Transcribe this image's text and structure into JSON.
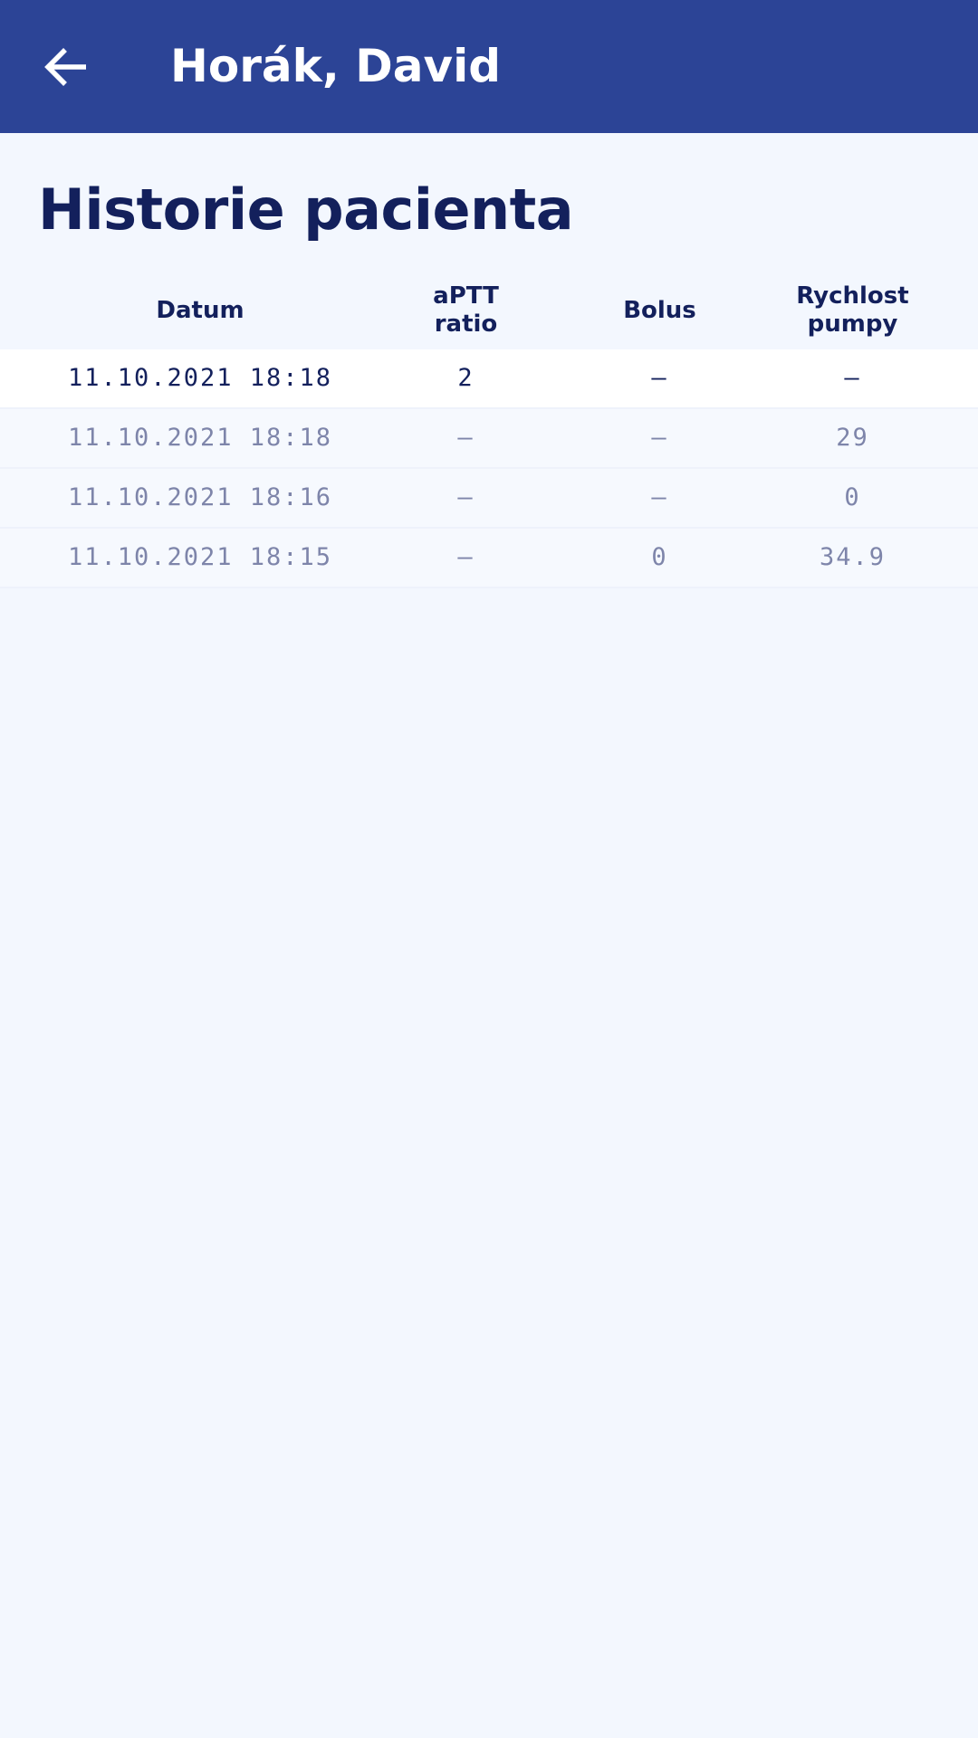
{
  "app_bar": {
    "title": "Horák, David",
    "back_icon": "arrow-left-icon",
    "background": "#2c4496"
  },
  "page": {
    "title": "Historie pacienta"
  },
  "table": {
    "headers": {
      "date": "Datum",
      "aptt": "aPTT ratio",
      "bolus": "Bolus",
      "rate_line1": "Rychlost",
      "rate_line2": "pumpy"
    },
    "rows": [
      {
        "date": "11.10.2021 18:18",
        "aptt": "2",
        "bolus": "–",
        "rate": "–",
        "active": true
      },
      {
        "date": "11.10.2021 18:18",
        "aptt": "–",
        "bolus": "–",
        "rate": "29",
        "active": false
      },
      {
        "date": "11.10.2021 18:16",
        "aptt": "–",
        "bolus": "–",
        "rate": "0",
        "active": false
      },
      {
        "date": "11.10.2021 18:15",
        "aptt": "–",
        "bolus": "0",
        "rate": "34.9",
        "active": false
      }
    ]
  },
  "colors": {
    "primary": "#2c4496",
    "text_dark": "#13205c",
    "text_muted": "#7e85aa",
    "background": "#f3f7fe"
  }
}
